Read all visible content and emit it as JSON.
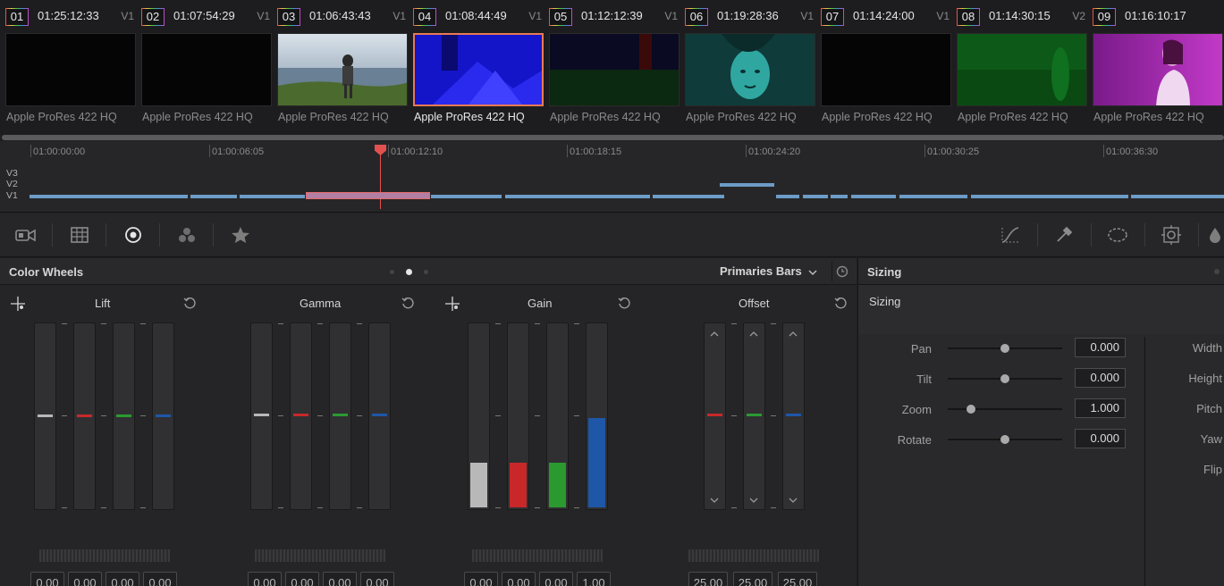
{
  "clips": [
    {
      "num": "01",
      "timecode": "01:25:12:33",
      "track": "V1",
      "codec": "Apple ProRes 422 HQ",
      "selected": false
    },
    {
      "num": "02",
      "timecode": "01:07:54:29",
      "track": "V1",
      "codec": "Apple ProRes 422 HQ",
      "selected": false
    },
    {
      "num": "03",
      "timecode": "01:06:43:43",
      "track": "V1",
      "codec": "Apple ProRes 422 HQ",
      "selected": false
    },
    {
      "num": "04",
      "timecode": "01:08:44:49",
      "track": "V1",
      "codec": "Apple ProRes 422 HQ",
      "selected": true
    },
    {
      "num": "05",
      "timecode": "01:12:12:39",
      "track": "V1",
      "codec": "Apple ProRes 422 HQ",
      "selected": false
    },
    {
      "num": "06",
      "timecode": "01:19:28:36",
      "track": "V1",
      "codec": "Apple ProRes 422 HQ",
      "selected": false
    },
    {
      "num": "07",
      "timecode": "01:14:24:00",
      "track": "V1",
      "codec": "Apple ProRes 422 HQ",
      "selected": false
    },
    {
      "num": "08",
      "timecode": "01:14:30:15",
      "track": "V2",
      "codec": "Apple ProRes 422 HQ",
      "selected": false
    },
    {
      "num": "09",
      "timecode": "01:16:10:17",
      "track": "",
      "codec": "Apple ProRes 422 HQ",
      "selected": false
    }
  ],
  "timeline": {
    "ruler": [
      "01:00:00:00",
      "01:00:06:05",
      "01:00:12:10",
      "01:00:18:15",
      "01:00:24:20",
      "01:00:30:25",
      "01:00:36:30"
    ],
    "tracks": [
      "V3",
      "V2",
      "V1"
    ]
  },
  "toolbar": {
    "left_icons": [
      "camera-raw-icon",
      "match-grid-icon",
      "color-wheels-icon",
      "color-warper-icon",
      "hdr-star-icon"
    ],
    "right_icons": [
      "curves-icon",
      "qualifier-picker-icon",
      "power-window-icon",
      "tracker-icon",
      "blur-drop-icon"
    ]
  },
  "color_wheels": {
    "title": "Color Wheels",
    "mode": "Primaries Bars",
    "groups": [
      {
        "name": "Lift",
        "labels": [
          "Y",
          "R",
          "G",
          "B"
        ],
        "values": [
          "0.00",
          "0.00",
          "0.00",
          "0.00"
        ]
      },
      {
        "name": "Gamma",
        "labels": [
          "Y",
          "R",
          "G",
          "B"
        ],
        "values": [
          "0.00",
          "0.00",
          "0.00",
          "0.00"
        ]
      },
      {
        "name": "Gain",
        "labels": [
          "Y",
          "R",
          "G",
          "B"
        ],
        "values": [
          "0.00",
          "0.00",
          "0.00",
          "1.00"
        ]
      },
      {
        "name": "Offset",
        "labels": [
          "R",
          "G",
          "B"
        ],
        "values": [
          "25.00",
          "25.00",
          "25.00"
        ]
      }
    ],
    "bar_colors": {
      "Y": "#b8b8b8",
      "R": "#c8282a",
      "G": "#2a9a30",
      "B": "#1f57a8"
    }
  },
  "sizing": {
    "title": "Sizing",
    "subtitle": "Sizing",
    "params": [
      {
        "label": "Pan",
        "value": "0.000",
        "level": 0.5
      },
      {
        "label": "Tilt",
        "value": "0.000",
        "level": 0.5
      },
      {
        "label": "Zoom",
        "value": "1.000",
        "level": 0.2
      },
      {
        "label": "Rotate",
        "value": "0.000",
        "level": 0.5
      }
    ],
    "right_params": [
      "Width",
      "Height",
      "Pitch",
      "Yaw",
      "Flip"
    ]
  }
}
